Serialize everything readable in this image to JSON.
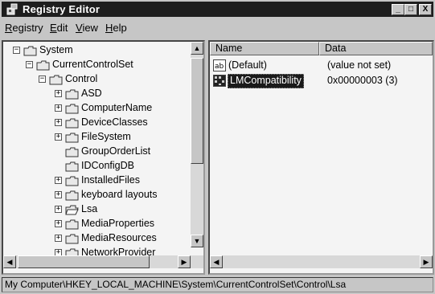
{
  "window": {
    "title": "Registry Editor",
    "min_label": "_",
    "max_label": "□",
    "close_label": "X"
  },
  "menu": {
    "registry": "Registry",
    "edit": "Edit",
    "view": "View",
    "help": "Help"
  },
  "tree": [
    {
      "label": "System",
      "expander": "−"
    },
    {
      "label": "CurrentControlSet",
      "expander": "−"
    },
    {
      "label": "Control",
      "expander": "−"
    },
    {
      "label": "ASD",
      "expander": "+"
    },
    {
      "label": "ComputerName",
      "expander": "+"
    },
    {
      "label": "DeviceClasses",
      "expander": "+"
    },
    {
      "label": "FileSystem",
      "expander": "+"
    },
    {
      "label": "GroupOrderList",
      "expander": ""
    },
    {
      "label": "IDConfigDB",
      "expander": ""
    },
    {
      "label": "InstalledFiles",
      "expander": "+"
    },
    {
      "label": "keyboard layouts",
      "expander": "+"
    },
    {
      "label": "Lsa",
      "expander": "+"
    },
    {
      "label": "MediaProperties",
      "expander": "+"
    },
    {
      "label": "MediaResources",
      "expander": "+"
    },
    {
      "label": "NetworkProvider",
      "expander": "+"
    }
  ],
  "list": {
    "headers": {
      "name": "Name",
      "data": "Data"
    },
    "rows": [
      {
        "icon": "ab",
        "name": "(Default)",
        "data": "(value not set)"
      },
      {
        "icon": "binary-value-icon",
        "name": "LMCompatibility",
        "data": "0x00000003 (3)"
      }
    ]
  },
  "status": {
    "path": "My Computer\\HKEY_LOCAL_MACHINE\\System\\CurrentControlSet\\Control\\Lsa"
  },
  "colors": {
    "titlebar": "#1e1e1e",
    "selection": "#1a1a1a",
    "folder": "#e8e8e8"
  }
}
